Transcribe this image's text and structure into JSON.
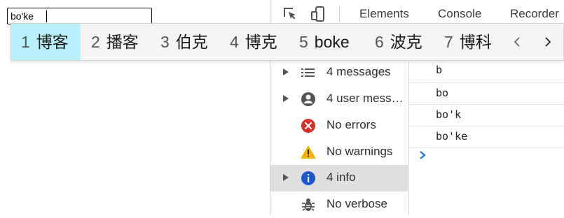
{
  "page": {
    "input_value": "bo'ke"
  },
  "devtools": {
    "tabs": [
      "Elements",
      "Console",
      "Recorder"
    ],
    "icons": {
      "inspect": "inspect-element-icon",
      "device": "device-toolbar-icon"
    },
    "sidebar": [
      {
        "label": "4 messages",
        "icon": "list-icon",
        "expandable": true,
        "active": false
      },
      {
        "label": "4 user mess…",
        "icon": "user-icon",
        "expandable": true,
        "active": false
      },
      {
        "label": "No errors",
        "icon": "error-icon",
        "expandable": false,
        "active": false
      },
      {
        "label": "No warnings",
        "icon": "warning-icon",
        "expandable": false,
        "active": false
      },
      {
        "label": "4 info",
        "icon": "info-icon",
        "expandable": true,
        "active": true
      },
      {
        "label": "No verbose",
        "icon": "bug-icon",
        "expandable": false,
        "active": false
      }
    ],
    "console_lines": [
      "b",
      "bo",
      "bo'k",
      "bo'ke"
    ]
  },
  "ime": {
    "candidates": [
      {
        "num": "1",
        "text": "博客",
        "selected": true
      },
      {
        "num": "2",
        "text": "播客",
        "selected": false
      },
      {
        "num": "3",
        "text": "伯克",
        "selected": false
      },
      {
        "num": "4",
        "text": "博克",
        "selected": false
      },
      {
        "num": "5",
        "text": "boke",
        "selected": false
      },
      {
        "num": "6",
        "text": "波克",
        "selected": false
      },
      {
        "num": "7",
        "text": "博科",
        "selected": false
      }
    ],
    "nav": {
      "prev": "chevron-left-icon",
      "next": "chevron-right-icon"
    }
  },
  "colors": {
    "selected_candidate": "#b8f0fb",
    "error": "#d93025",
    "warning": "#f2b600",
    "info": "#1a56d6",
    "prompt": "#1a73e8"
  }
}
